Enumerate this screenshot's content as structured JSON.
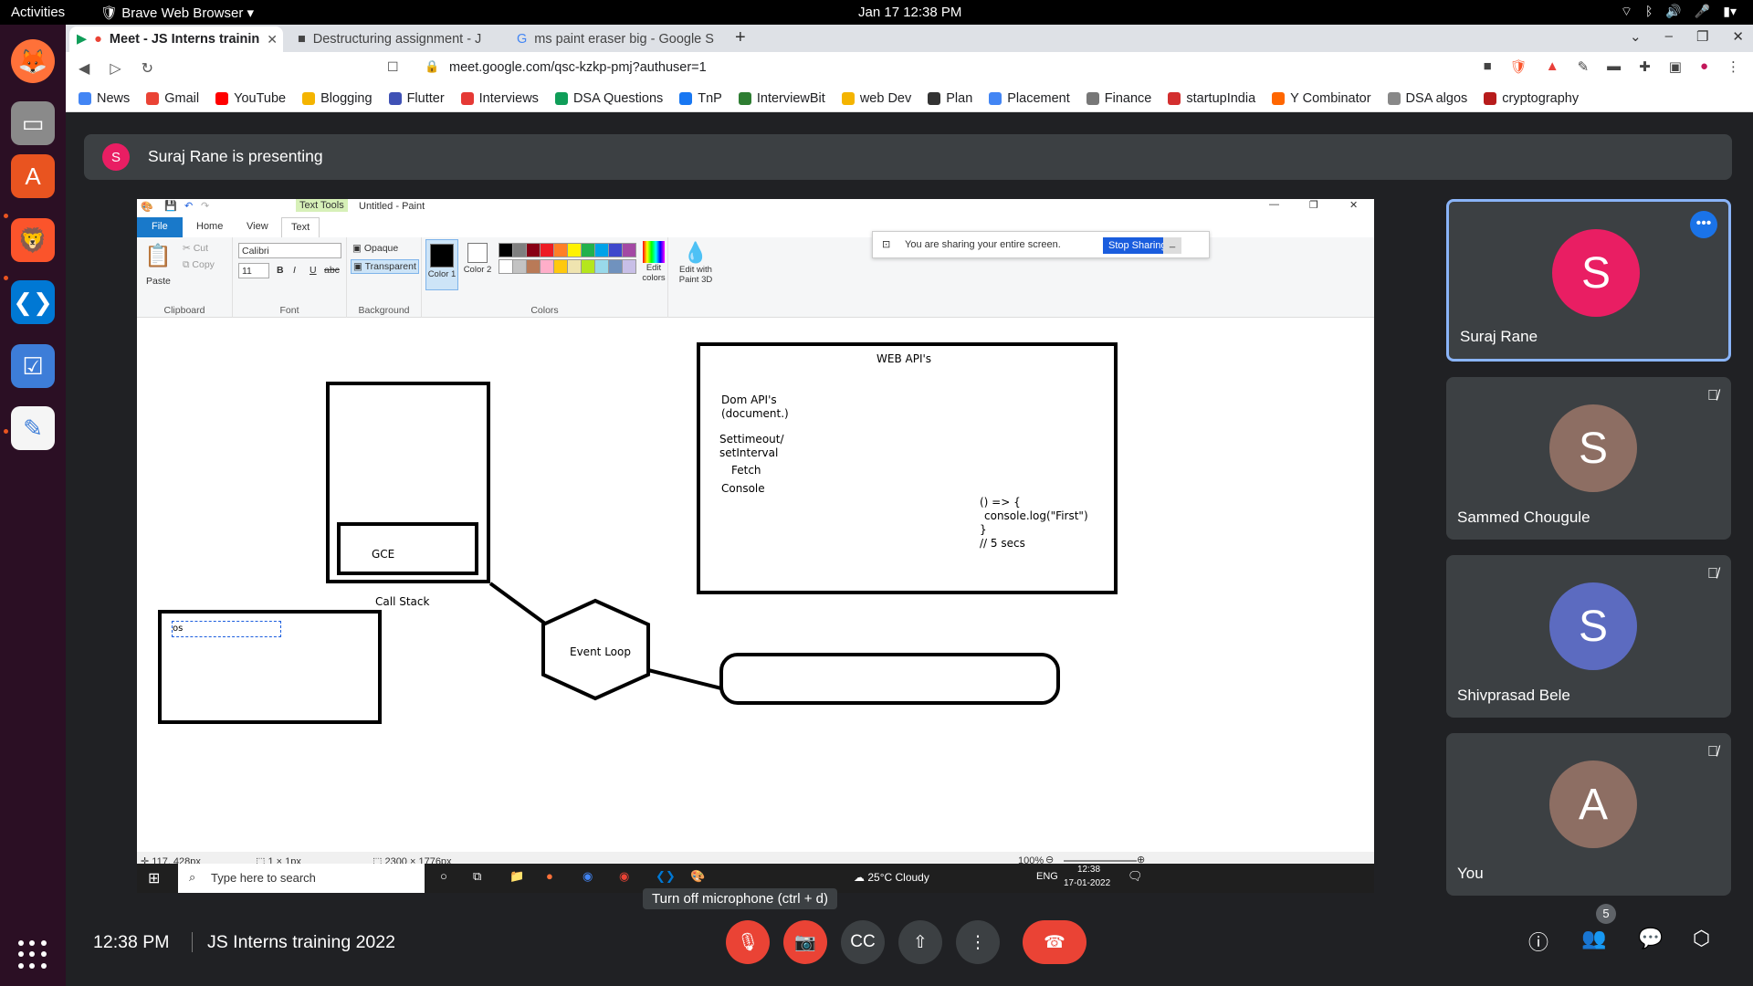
{
  "os": {
    "activities": "Activities",
    "app_name": "Brave Web Browser",
    "clock": "Jan 17  12:38 PM"
  },
  "browser": {
    "tabs": [
      {
        "label": "Meet - JS Interns trainin",
        "active": true
      },
      {
        "label": "Destructuring assignment - J",
        "active": false
      },
      {
        "label": "ms paint eraser big - Google S",
        "active": false
      }
    ],
    "url": "meet.google.com/qsc-kzkp-pmj?authuser=1",
    "bookmarks": [
      "News",
      "Gmail",
      "YouTube",
      "Blogging",
      "Flutter",
      "Interviews",
      "DSA Questions",
      "TnP",
      "InterviewBit",
      "web Dev",
      "Plan",
      "Placement",
      "Finance",
      "startupIndia",
      "Y Combinator",
      "DSA algos",
      "cryptography"
    ],
    "bookmark_colors": [
      "#4285f4",
      "#ea4335",
      "#ff0000",
      "#f4b400",
      "#3f51b5",
      "#e53935",
      "#0f9d58",
      "#1877f2",
      "#2e7d32",
      "#f4b400",
      "#333333",
      "#4285f4",
      "#777777",
      "#d32f2f",
      "#ff6600",
      "#888888",
      "#b71c1c"
    ]
  },
  "meet": {
    "banner": {
      "initial": "S",
      "text": "Suraj Rane is presenting"
    },
    "time": "12:38 PM",
    "meeting_title": "JS Interns training 2022",
    "tooltip": "Turn off microphone (ctrl + d)",
    "participant_count": "5",
    "participants": [
      {
        "name": "Suraj Rane",
        "initial": "S",
        "color": "#e91e63",
        "muted": false,
        "active": true
      },
      {
        "name": "Sammed Chougule",
        "initial": "S",
        "color": "#8d6e63",
        "muted": true,
        "active": false
      },
      {
        "name": "Shivprasad Bele",
        "initial": "S",
        "color": "#5c6bc0",
        "muted": true,
        "active": false
      },
      {
        "name": "You",
        "initial": "A",
        "color": "#8d6e63",
        "muted": true,
        "active": false
      }
    ]
  },
  "paint": {
    "text_tools": "Text Tools",
    "title": "Untitled - Paint",
    "tabs": {
      "file": "File",
      "home": "Home",
      "view": "View",
      "text": "Text"
    },
    "clipboard": {
      "paste": "Paste",
      "cut": "Cut",
      "copy": "Copy",
      "group": "Clipboard"
    },
    "font": {
      "name": "Calibri",
      "size": "11",
      "group": "Font"
    },
    "background": {
      "opaque": "Opaque",
      "transparent": "Transparent",
      "group": "Background"
    },
    "colors": {
      "color1": "Color 1",
      "color2": "Color 2",
      "edit": "Edit colors",
      "paint3d": "Edit with Paint 3D",
      "group": "Colors"
    },
    "swatches_row1": [
      "#000000",
      "#7f7f7f",
      "#880015",
      "#ed1c24",
      "#ff7f27",
      "#fff200",
      "#22b14c",
      "#00a2e8",
      "#3f48cc",
      "#a349a4"
    ],
    "swatches_row2": [
      "#ffffff",
      "#c3c3c3",
      "#b97a57",
      "#ffaec9",
      "#ffc90e",
      "#efe4b0",
      "#b5e61d",
      "#99d9ea",
      "#7092be",
      "#c8bfe7"
    ],
    "share_notice": {
      "text": "You are sharing your entire screen.",
      "button": "Stop Sharing"
    },
    "canvas": {
      "web_apis": "WEB API's",
      "dom_api": "Dom API's",
      "document": "(document.)",
      "settimeout": "Settimeout/",
      "setinterval": "setInterval",
      "fetch": "Fetch",
      "console": "Console",
      "code1": "() => {",
      "code2": "console.log(\"First\")",
      "code3": "}",
      "code4": "// 5 secs",
      "gce": "GCE",
      "call_stack": "Call Stack",
      "event_loop": "Event Loop",
      "typed": "os"
    },
    "status": {
      "position": "117, 428px",
      "selection": "1 × 1px",
      "size": "2300 × 1776px",
      "zoom": "100%"
    }
  },
  "windows_taskbar": {
    "search_placeholder": "Type here to search",
    "weather": "25°C  Cloudy",
    "lang": "ENG",
    "time": "12:38",
    "date": "17-01-2022"
  }
}
